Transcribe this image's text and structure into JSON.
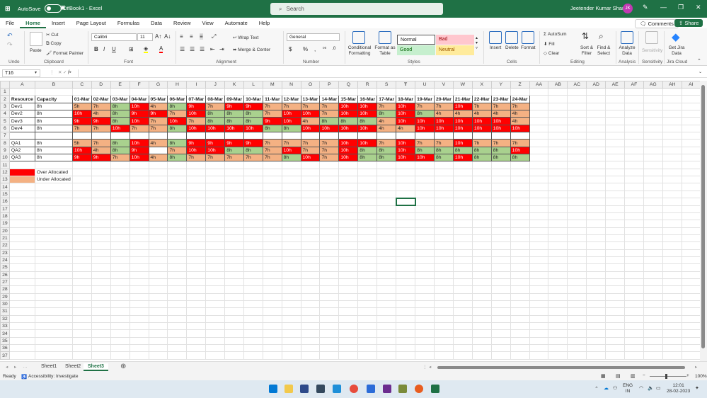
{
  "titlebar": {
    "autosave_label": "AutoSave",
    "autosave_state": "Off",
    "title": "Book1 - Excel",
    "search_placeholder": "Search",
    "user_name": "Jeetender Kumar Sharma",
    "user_initials": "JK"
  },
  "menu": [
    "File",
    "Home",
    "Insert",
    "Page Layout",
    "Formulas",
    "Data",
    "Review",
    "View",
    "Automate",
    "Help"
  ],
  "menu_active": "Home",
  "comments_label": "Comments",
  "share_label": "Share",
  "ribbon": {
    "undo": "Undo",
    "clipboard": {
      "label": "Clipboard",
      "paste": "Paste",
      "cut": "Cut",
      "copy": "Copy",
      "format_painter": "Format Painter"
    },
    "font": {
      "label": "Font",
      "name": "Calibri",
      "size": "11",
      "bold": "B",
      "italic": "I",
      "underline": "U"
    },
    "alignment": {
      "label": "Alignment",
      "wrap": "Wrap Text",
      "merge": "Merge & Center"
    },
    "number": {
      "label": "Number",
      "format": "General",
      "currency": "$",
      "percent": "%",
      "comma": ","
    },
    "styles": {
      "label": "Styles",
      "conditional": "Conditional Formatting",
      "format_table": "Format as Table",
      "normal": "Normal",
      "bad": "Bad",
      "good": "Good",
      "neutral": "Neutral"
    },
    "cells": {
      "label": "Cells",
      "insert": "Insert",
      "delete": "Delete",
      "format": "Format"
    },
    "editing": {
      "label": "Editing",
      "autosum": "AutoSum",
      "fill": "Fill",
      "clear": "Clear",
      "sort_filter": "Sort & Filter",
      "find_select": "Find & Select"
    },
    "analysis": {
      "label": "Analysis",
      "analyze": "Analyze Data"
    },
    "sensitivity": {
      "label": "Sensitivity",
      "btn": "Sensitivity"
    },
    "jira": {
      "label": "Jira Cloud",
      "btn": "Get Jira Data"
    }
  },
  "formula_bar": {
    "name_box": "T16",
    "fx": "fx",
    "value": ""
  },
  "columns": [
    "A",
    "B",
    "C",
    "D",
    "E",
    "F",
    "G",
    "H",
    "I",
    "J",
    "K",
    "L",
    "M",
    "N",
    "O",
    "P",
    "Q",
    "R",
    "S",
    "T",
    "U",
    "V",
    "W",
    "X",
    "Y",
    "Z",
    "AA",
    "AB",
    "AC",
    "AD",
    "AE",
    "AF",
    "AG",
    "AH",
    "AI"
  ],
  "selected_cell": {
    "col": "T",
    "row": 16
  },
  "header_row": [
    "Resource",
    "Capacity",
    "01-Mar",
    "02-Mar",
    "03-Mar",
    "04-Mar",
    "05-Mar",
    "06-Mar",
    "07-Mar",
    "08-Mar",
    "09-Mar",
    "10-Mar",
    "11-Mar",
    "12-Mar",
    "13-Mar",
    "14-Mar",
    "15-Mar",
    "16-Mar",
    "17-Mar",
    "18-Mar",
    "19-Mar",
    "20-Mar",
    "21-Mar",
    "22-Mar",
    "23-Mar",
    "24-Mar"
  ],
  "data_rows": [
    {
      "row": 3,
      "cells": [
        "Dev1",
        "8h",
        "5h",
        "7h",
        "8h",
        "10h",
        "4h",
        "8h",
        "9h",
        "7h",
        "9h",
        "9h",
        "7h",
        "7h",
        "7h",
        "7h",
        "10h",
        "10h",
        "7h",
        "10h",
        "7h",
        "7h",
        "10h",
        "7h",
        "7h",
        "7h"
      ],
      "fill": [
        "",
        "",
        "o",
        "o",
        "g",
        "r",
        "o",
        "g",
        "r",
        "o",
        "r",
        "r",
        "o",
        "o",
        "o",
        "o",
        "r",
        "r",
        "o",
        "r",
        "o",
        "o",
        "r",
        "o",
        "o",
        "o"
      ]
    },
    {
      "row": 4,
      "cells": [
        "Dev2",
        "8h",
        "10h",
        "4h",
        "8h",
        "9h",
        "9h",
        "7h",
        "10h",
        "8h",
        "8h",
        "8h",
        "7h",
        "10h",
        "10h",
        "7h",
        "10h",
        "10h",
        "8h",
        "10h",
        "8h",
        "4h",
        "4h",
        "4h",
        "4h",
        "4h"
      ],
      "fill": [
        "",
        "",
        "r",
        "o",
        "g",
        "r",
        "r",
        "o",
        "r",
        "g",
        "g",
        "g",
        "o",
        "r",
        "r",
        "o",
        "r",
        "r",
        "g",
        "r",
        "g",
        "o",
        "o",
        "o",
        "o",
        "o"
      ]
    },
    {
      "row": 5,
      "cells": [
        "Dev3",
        "8h",
        "9h",
        "9h",
        "8h",
        "10h",
        "7h",
        "10h",
        "7h",
        "8h",
        "8h",
        "8h",
        "9h",
        "10h",
        "4h",
        "8h",
        "8h",
        "8h",
        "4h",
        "10h",
        "10h",
        "10h",
        "10h",
        "10h",
        "10h",
        "4h"
      ],
      "fill": [
        "",
        "",
        "r",
        "r",
        "g",
        "r",
        "o",
        "r",
        "o",
        "g",
        "g",
        "g",
        "r",
        "r",
        "o",
        "g",
        "g",
        "g",
        "o",
        "r",
        "r",
        "r",
        "r",
        "r",
        "r",
        "o"
      ]
    },
    {
      "row": 6,
      "cells": [
        "Dev4",
        "8h",
        "7h",
        "7h",
        "10h",
        "7h",
        "7h",
        "8h",
        "10h",
        "10h",
        "10h",
        "10h",
        "8h",
        "8h",
        "10h",
        "10h",
        "10h",
        "10h",
        "4h",
        "4h",
        "10h",
        "10h",
        "10h",
        "10h",
        "10h",
        "10h"
      ],
      "fill": [
        "",
        "",
        "o",
        "o",
        "r",
        "o",
        "o",
        "g",
        "r",
        "r",
        "r",
        "r",
        "g",
        "g",
        "r",
        "r",
        "r",
        "r",
        "o",
        "o",
        "r",
        "r",
        "r",
        "r",
        "r",
        "r"
      ]
    },
    {
      "row": 7,
      "cells": [
        "",
        "",
        "",
        "",
        "",
        "",
        "",
        "",
        "",
        "",
        "",
        "",
        "",
        "",
        "",
        "",
        "",
        "",
        "",
        "",
        "",
        "",
        "",
        "",
        "",
        ""
      ],
      "fill": [
        "",
        "",
        "",
        "",
        "",
        "",
        "",
        "",
        "",
        "",
        "",
        "",
        "",
        "",
        "",
        "",
        "",
        "",
        "",
        "",
        "",
        "",
        "",
        "",
        "",
        ""
      ]
    },
    {
      "row": 8,
      "cells": [
        "QA1",
        "8h",
        "5h",
        "7h",
        "8h",
        "10h",
        "4h",
        "8h",
        "9h",
        "9h",
        "9h",
        "9h",
        "7h",
        "7h",
        "7h",
        "7h",
        "10h",
        "10h",
        "7h",
        "10h",
        "7h",
        "7h",
        "10h",
        "7h",
        "7h",
        "7h"
      ],
      "fill": [
        "",
        "",
        "o",
        "o",
        "g",
        "r",
        "o",
        "g",
        "r",
        "r",
        "r",
        "r",
        "o",
        "o",
        "o",
        "o",
        "r",
        "r",
        "o",
        "r",
        "o",
        "o",
        "r",
        "o",
        "o",
        "o"
      ]
    },
    {
      "row": 9,
      "cells": [
        "QA2",
        "8h",
        "10h",
        "4h",
        "8h",
        "9h",
        "",
        "7h",
        "10h",
        "10h",
        "8h",
        "8h",
        "7h",
        "10h",
        "7h",
        "7h",
        "10h",
        "8h",
        "8h",
        "10h",
        "8h",
        "8h",
        "8h",
        "8h",
        "8h",
        "10h"
      ],
      "fill": [
        "",
        "",
        "r",
        "o",
        "g",
        "r",
        "",
        "o",
        "r",
        "r",
        "g",
        "g",
        "o",
        "r",
        "o",
        "o",
        "r",
        "g",
        "g",
        "r",
        "g",
        "g",
        "g",
        "g",
        "g",
        "r"
      ]
    },
    {
      "row": 10,
      "cells": [
        "QA3",
        "8h",
        "9h",
        "9h",
        "7h",
        "10h",
        "4h",
        "8h",
        "7h",
        "7h",
        "7h",
        "7h",
        "7h",
        "8h",
        "10h",
        "7h",
        "10h",
        "8h",
        "8h",
        "10h",
        "10h",
        "8h",
        "10h",
        "8h",
        "8h",
        "8h"
      ],
      "fill": [
        "",
        "",
        "r",
        "r",
        "o",
        "r",
        "o",
        "g",
        "o",
        "o",
        "o",
        "o",
        "o",
        "g",
        "r",
        "o",
        "r",
        "g",
        "g",
        "r",
        "r",
        "g",
        "r",
        "g",
        "g",
        "g"
      ]
    }
  ],
  "legend": [
    {
      "row": 12,
      "label": "Over Allocated",
      "fill": "r"
    },
    {
      "row": 13,
      "label": "Under Allocated",
      "fill": "o"
    }
  ],
  "total_rows": 37,
  "sheets": [
    "Sheet1",
    "Sheet2",
    "Sheet3"
  ],
  "active_sheet": "Sheet3",
  "status": {
    "ready": "Ready",
    "accessibility": "Accessibility: Investigate",
    "zoom": "100%"
  },
  "taskbar": {
    "lang_top": "ENG",
    "lang_bottom": "IN",
    "time": "12:01",
    "date": "28-02-2023"
  },
  "colors": {
    "accent": "#1f7145",
    "over": "#ff0000",
    "under": "#f4b183",
    "ok": "#a9d18e"
  }
}
